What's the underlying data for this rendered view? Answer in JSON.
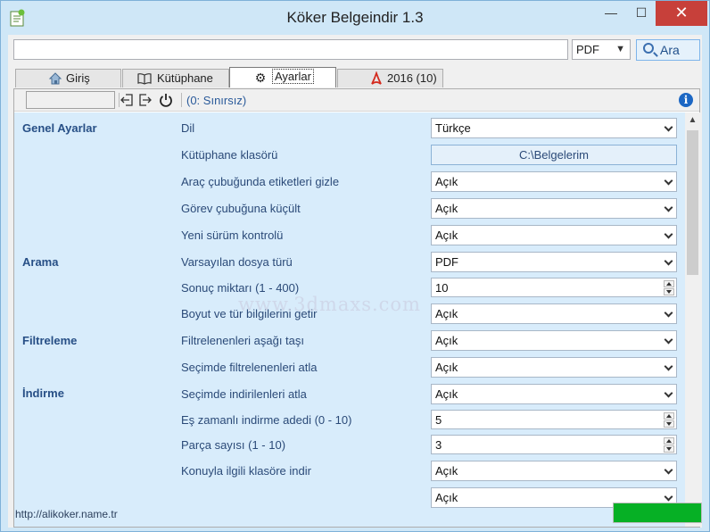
{
  "window": {
    "title": "Köker Belgeindir 1.3",
    "min_glyph": "—",
    "max_glyph": "☐",
    "close_glyph": "✕"
  },
  "search": {
    "query": "",
    "format_selected": "PDF",
    "search_button": "Ara"
  },
  "tabs": [
    {
      "label": "Giriş",
      "icon": "home-icon",
      "active": false
    },
    {
      "label": "Kütüphane",
      "icon": "book-icon",
      "active": false
    },
    {
      "label": "Ayarlar",
      "icon": "gear-icon",
      "active": true
    },
    {
      "label": "2016 (10)",
      "icon": "pdf-icon",
      "active": false
    }
  ],
  "toolbar": {
    "limit_label": "(0: Sınırsız)"
  },
  "sections": {
    "genel": "Genel Ayarlar",
    "arama": "Arama",
    "filtreleme": "Filtreleme",
    "indirme": "İndirme"
  },
  "settings": [
    {
      "label": "Dil",
      "type": "select",
      "value": "Türkçe"
    },
    {
      "label": "Kütüphane klasörü",
      "type": "button",
      "value": "C:\\Belgelerim"
    },
    {
      "label": "Araç çubuğunda etiketleri gizle",
      "type": "select",
      "value": "Açık"
    },
    {
      "label": "Görev çubuğuna küçült",
      "type": "select",
      "value": "Açık"
    },
    {
      "label": "Yeni sürüm kontrolü",
      "type": "select",
      "value": "Açık"
    },
    {
      "label": "Varsayılan dosya türü",
      "type": "select",
      "value": "PDF"
    },
    {
      "label": "Sonuç miktarı (1 - 400)",
      "type": "spinner",
      "value": "10"
    },
    {
      "label": "Boyut ve tür bilgilerini getir",
      "type": "select",
      "value": "Açık"
    },
    {
      "label": "Filtrelenenleri aşağı taşı",
      "type": "select",
      "value": "Açık"
    },
    {
      "label": "Seçimde filtrelenenleri atla",
      "type": "select",
      "value": "Açık"
    },
    {
      "label": "Seçimde indirilenleri atla",
      "type": "select",
      "value": "Açık"
    },
    {
      "label": "Eş zamanlı indirme adedi (0 - 10)",
      "type": "spinner",
      "value": "5"
    },
    {
      "label": "Parça sayısı (1 - 10)",
      "type": "spinner",
      "value": "3"
    },
    {
      "label": "Konuyla ilgili klasöre indir",
      "type": "select",
      "value": "Açık"
    },
    {
      "label": "",
      "type": "select",
      "value": "Açık"
    }
  ],
  "watermark": "www.3dmaxs.com",
  "status": {
    "url": "http://alikoker.name.tr",
    "progress": 1.0
  },
  "colors": {
    "accent": "#1c67c4",
    "section_text": "#274f86",
    "settings_bg": "#d8ecfb",
    "progress_fill": "#06b025",
    "close_button": "#c7403a"
  }
}
